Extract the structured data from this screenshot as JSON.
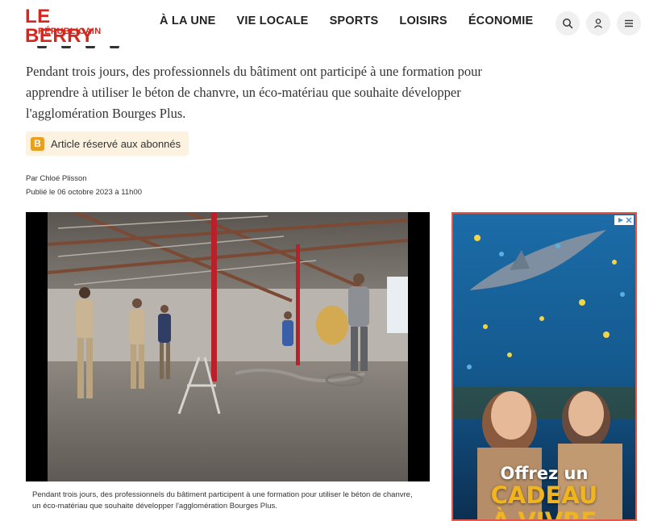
{
  "header": {
    "logo": {
      "line1": "LE BERRY",
      "line2": "RÉPUBLICAIN",
      "color": "#d6271f"
    },
    "nav": [
      "À LA UNE",
      "VIE LOCALE",
      "SPORTS",
      "LOISIRS",
      "ÉCONOMIE"
    ],
    "icons": [
      "search-icon",
      "user-icon",
      "menu-icon"
    ]
  },
  "article": {
    "chapeau": "Pendant trois jours, des professionnels du bâtiment ont participé à une formation pour apprendre à utiliser le béton de chanvre, un éco-matériau que souhaite développer l'agglomération Bourges Plus.",
    "badge": {
      "letter": "B",
      "label": "Article réservé aux abonnés"
    },
    "author": "Par Chloé Plisson",
    "published": "Publié le 06 octobre 2023 à 11h00",
    "caption": "Pendant trois jours, des professionnels du bâtiment participent à une formation pour utiliser le béton de chanvre, un éco-matériau que souhaite développer l'agglomération Bourges Plus."
  },
  "ad": {
    "line1": "Offrez un",
    "line2": "CADEAU",
    "line3": "À VIVRE",
    "border_color": "#e2584a"
  }
}
